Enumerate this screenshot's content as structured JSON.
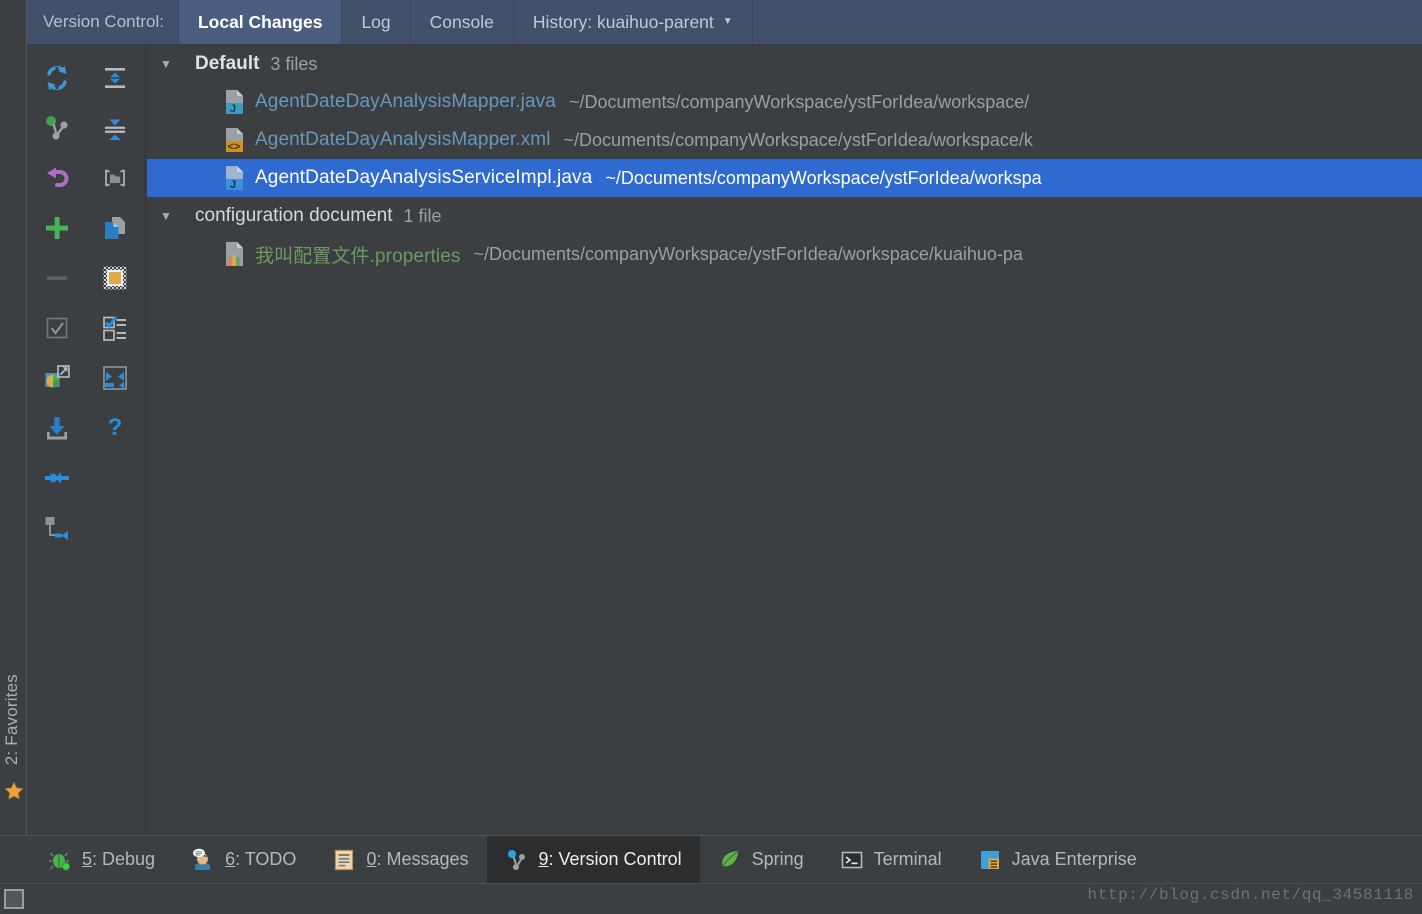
{
  "window": {
    "favorites_tool_label": "2: Favorites",
    "favorites_shortcut": "2"
  },
  "tabbar": {
    "tool_label": "Version Control:",
    "tabs": [
      {
        "label": "Local Changes",
        "active": true
      },
      {
        "label": "Log",
        "active": false
      },
      {
        "label": "Console",
        "active": false
      },
      {
        "label": "History: kuaihuo-parent",
        "active": false,
        "caret": "▼"
      }
    ]
  },
  "toolbar": {
    "column_left": [
      {
        "name": "refresh-icon",
        "title": "Refresh"
      },
      {
        "name": "show-diff-icon",
        "title": "Show Diff"
      },
      {
        "name": "rollback-icon",
        "title": "Rollback"
      },
      {
        "name": "add-icon",
        "title": "Add to VCS"
      },
      {
        "name": "remove-icon",
        "title": "Delete"
      },
      {
        "name": "checkbox-icon",
        "title": "Select All"
      },
      {
        "name": "shelve-icon",
        "title": "Shelve Changes"
      },
      {
        "name": "commit-icon",
        "title": "Commit"
      },
      {
        "name": "collapse-arrows-icon",
        "title": "Collapse"
      },
      {
        "name": "move-to-changelist-icon",
        "title": "Move to Another Changelist"
      }
    ],
    "column_right": [
      {
        "name": "expand-all-icon",
        "title": "Expand All"
      },
      {
        "name": "collapse-all-icon",
        "title": "Collapse All"
      },
      {
        "name": "group-by-directory-icon",
        "title": "Group by Directory"
      },
      {
        "name": "copy-icon",
        "title": "Copy"
      },
      {
        "name": "ignore-icon",
        "title": "Configure Ignored Files"
      },
      {
        "name": "changelist-icon",
        "title": "Changelists"
      },
      {
        "name": "revert-selection-icon",
        "title": "Revert Selection"
      },
      {
        "name": "help-icon",
        "title": "Help"
      }
    ]
  },
  "changes": {
    "groups": [
      {
        "expanded": true,
        "triangle": "▼",
        "name": "Default",
        "bold": true,
        "count": "3 files",
        "files": [
          {
            "name": "AgentDateDayAnalysisMapper.java",
            "path": "~/Documents/companyWorkspace/ystForIdea/workspace/",
            "icon": "java-file-icon",
            "badge": "J",
            "badge_color": "#3b9cbf",
            "color_class": "java",
            "selected": false
          },
          {
            "name": "AgentDateDayAnalysisMapper.xml",
            "path": "~/Documents/companyWorkspace/ystForIdea/workspace/k",
            "icon": "xml-file-icon",
            "badge": "<>",
            "badge_color": "#cf9024",
            "color_class": "java",
            "selected": false
          },
          {
            "name": "AgentDateDayAnalysisServiceImpl.java",
            "path": "~/Documents/companyWorkspace/ystForIdea/workspa",
            "icon": "java-file-icon",
            "badge": "J",
            "badge_color": "#3e8ede",
            "color_class": "java",
            "selected": true
          }
        ]
      },
      {
        "expanded": true,
        "triangle": "▼",
        "name": "configuration document",
        "bold": false,
        "count": "1 file",
        "files": [
          {
            "name": "我叫配置文件.properties",
            "path": "~/Documents/companyWorkspace/ystForIdea/workspace/kuaihuo-pa",
            "icon": "properties-file-icon",
            "badge": "‖",
            "badge_color": "#d98b2b",
            "color_class": "prop",
            "selected": false
          }
        ]
      }
    ]
  },
  "bottom_tools": [
    {
      "label": "5: Debug",
      "shortcut": "5",
      "rest": ": Debug",
      "icon": "debug-bug-icon",
      "active": false
    },
    {
      "label": "6: TODO",
      "shortcut": "6",
      "rest": ": TODO",
      "icon": "todo-person-icon",
      "active": false
    },
    {
      "label": "0: Messages",
      "shortcut": "0",
      "rest": ": Messages",
      "icon": "messages-icon",
      "active": false
    },
    {
      "label": "9: Version Control",
      "shortcut": "9",
      "rest": ": Version Control",
      "icon": "version-control-icon",
      "active": true
    },
    {
      "label": "Spring",
      "shortcut": "",
      "rest": "Spring",
      "icon": "spring-leaf-icon",
      "active": false
    },
    {
      "label": "Terminal",
      "shortcut": "",
      "rest": "Terminal",
      "icon": "terminal-icon",
      "active": false
    },
    {
      "label": "Java Enterprise",
      "shortcut": "",
      "rest": "Java Enterprise",
      "icon": "java-enterprise-icon",
      "active": false
    }
  ],
  "statusbar": {
    "watermark": "http://blog.csdn.net/qq_34581118"
  },
  "colors": {
    "selection_blue": "#2f6ad0",
    "tabbar_blue": "#41516a",
    "panel_bg": "#3c3f41",
    "java_blue": "#6897bb",
    "properties_green": "#6a9b5c"
  }
}
